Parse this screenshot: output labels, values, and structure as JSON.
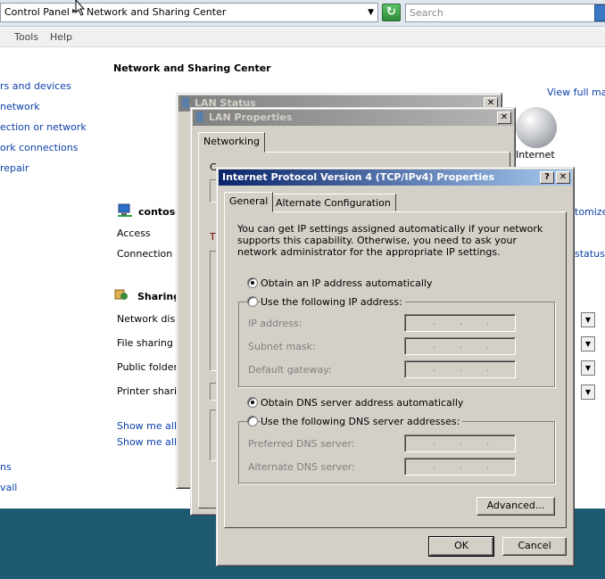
{
  "address_bar": {
    "crumb_1": "Control Panel",
    "crumb_2": "Network and Sharing Center",
    "search_placeholder": "Search"
  },
  "menu": {
    "tools": "Tools",
    "help": "Help"
  },
  "sidebar": {
    "items": [
      "rs and devices",
      "network",
      "ection or network",
      "ork connections",
      "repair"
    ],
    "bottom_items": [
      "ns",
      "vall"
    ]
  },
  "main": {
    "title": "Network and Sharing Center",
    "view_full_map": "View full map",
    "internet_label": "Internet",
    "network_name": "contoso",
    "customize": "tomize",
    "access_label": "Access",
    "connection_label": "Connection",
    "view_status": "status",
    "sharing_heading": "Sharing",
    "sharing_rows": [
      "Network disco",
      "File sharing",
      "Public folder s",
      "Printer sharin"
    ],
    "show_links": [
      "Show me all tl",
      "Show me all tl"
    ]
  },
  "lan_status": {
    "title": "LAN Status"
  },
  "lan_properties": {
    "title": "LAN Properties",
    "tab_networking": "Networking",
    "stub_1": "C",
    "stub_2": "T"
  },
  "ipv4_dialog": {
    "title": "Internet Protocol Version 4 (TCP/IPv4) Properties",
    "help_button": "?",
    "close_button": "✕",
    "tabs": [
      "General",
      "Alternate Configuration"
    ],
    "description": "You can get IP settings assigned automatically if your network supports this capability. Otherwise, you need to ask your network administrator for the appropriate IP settings.",
    "obtain_ip_auto": "Obtain an IP address automatically",
    "use_following_ip": "Use the following IP address:",
    "ip_address": "IP address:",
    "subnet_mask": "Subnet mask:",
    "default_gateway": "Default gateway:",
    "obtain_dns_auto": "Obtain DNS server address automatically",
    "use_following_dns": "Use the following DNS server addresses:",
    "preferred_dns": "Preferred DNS server:",
    "alternate_dns": "Alternate DNS server:",
    "ip_dot": ".",
    "advanced_button": "Advanced...",
    "ok_button": "OK",
    "cancel_button": "Cancel"
  }
}
